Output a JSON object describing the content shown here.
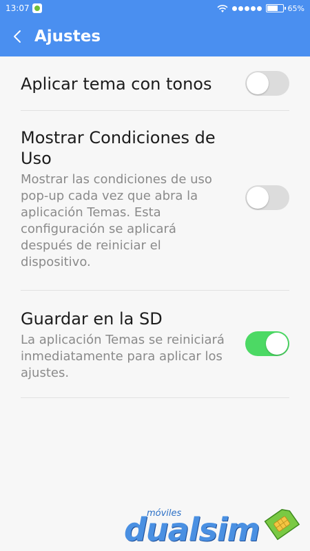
{
  "status_bar": {
    "time": "13:07",
    "battery": "65%"
  },
  "toolbar": {
    "title": "Ajustes"
  },
  "settings": [
    {
      "title": "Aplicar tema con tonos",
      "description": "",
      "enabled": false
    },
    {
      "title": "Mostrar Condiciones de Uso",
      "description": "Mostrar las condiciones de uso pop-up cada vez que abra la aplicación Temas. Esta configuración se aplicará después de reiniciar el dispositivo.",
      "enabled": false
    },
    {
      "title": "Guardar en la SD",
      "description": "La aplicación Temas se reiniciará inmediatamente para aplicar los ajustes.",
      "enabled": true
    }
  ],
  "watermark": {
    "small": "móviles",
    "brand": "dualsim"
  },
  "icons": {
    "back": "chevron-left-icon",
    "wifi": "wifi-icon",
    "battery": "battery-icon"
  },
  "colors": {
    "header": "#4a8ff0",
    "toggle_on": "#4cd964",
    "toggle_off": "#dcdcdc"
  }
}
